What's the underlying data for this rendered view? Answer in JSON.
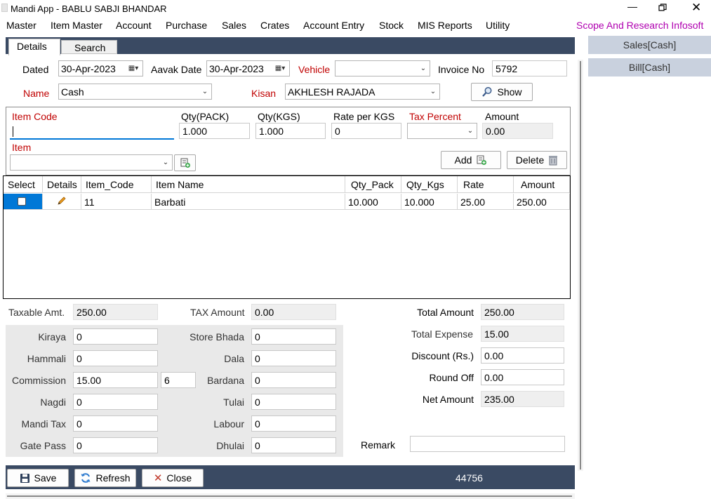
{
  "window": {
    "title": "Mandi App - BABLU SABJI BHANDAR"
  },
  "menu": {
    "items": [
      "Master",
      "Item Master",
      "Account",
      "Purchase",
      "Sales",
      "Crates",
      "Account Entry",
      "Stock",
      "MIS Reports",
      "Utility"
    ],
    "brand": "Scope And Research Infosoft"
  },
  "tabs": {
    "details": "Details",
    "search": "Search"
  },
  "side_buttons": {
    "sales_cash": "Sales[Cash]",
    "bill_cash": "Bill[Cash]"
  },
  "header": {
    "dated_label": "Dated",
    "dated_value": "30-Apr-2023",
    "aavak_label": "Aavak Date",
    "aavak_value": "30-Apr-2023",
    "vehicle_label": "Vehicle",
    "vehicle_value": "",
    "invoice_label": "Invoice No",
    "invoice_value": "5792",
    "name_label": "Name",
    "name_value": "Cash",
    "kisan_label": "Kisan",
    "kisan_value": "AKHLESH RAJADA",
    "show_label": "Show"
  },
  "entry": {
    "item_code_label": "Item Code",
    "item_code_value": "",
    "qty_pack_label": "Qty(PACK)",
    "qty_pack_value": "1.000",
    "qty_kgs_label": "Qty(KGS)",
    "qty_kgs_value": "1.000",
    "rate_label": "Rate per KGS",
    "rate_value": "0",
    "tax_label": "Tax Percent",
    "tax_value": "",
    "amount_label": "Amount",
    "amount_value": "0.00",
    "item_label": "Item",
    "item_value": "",
    "add_label": "Add",
    "delete_label": "Delete"
  },
  "grid": {
    "columns": [
      "Select",
      "Details",
      "Item_Code",
      "Item Name",
      "Qty_Pack",
      "Qty_Kgs",
      "Rate",
      "Amount"
    ],
    "rows": [
      {
        "item_code": "11",
        "item_name": "Barbati",
        "qty_pack": "10.000",
        "qty_kgs": "10.000",
        "rate": "25.00",
        "amount": "250.00"
      }
    ]
  },
  "summary": {
    "taxable_label": "Taxable Amt.",
    "taxable_value": "250.00",
    "tax_amount_label": "TAX Amount",
    "tax_amount_value": "0.00",
    "total_amount_label": "Total Amount",
    "total_amount_value": "250.00",
    "total_expense_label": "Total Expense",
    "total_expense_value": "15.00",
    "discount_label": "Discount (Rs.)",
    "discount_value": "0.00",
    "round_off_label": "Round Off",
    "round_off_value": "0.00",
    "net_amount_label": "Net Amount",
    "net_amount_value": "235.00",
    "remark_label": "Remark",
    "remark_value": ""
  },
  "expenses": {
    "kiraya_label": "Kiraya",
    "kiraya_value": "0",
    "hammali_label": "Hammali",
    "hammali_value": "0",
    "commission_label": "Commission",
    "commission_value": "15.00",
    "commission_pct": "6",
    "nagdi_label": "Nagdi",
    "nagdi_value": "0",
    "mandi_tax_label": "Mandi Tax",
    "mandi_tax_value": "0",
    "gate_pass_label": "Gate Pass",
    "gate_pass_value": "0",
    "store_bhada_label": "Store Bhada",
    "store_bhada_value": "0",
    "dala_label": "Dala",
    "dala_value": "0",
    "bardana_label": "Bardana",
    "bardana_value": "0",
    "tulai_label": "Tulai",
    "tulai_value": "0",
    "labour_label": "Labour",
    "labour_value": "0",
    "dhulai_label": "Dhulai",
    "dhulai_value": "0"
  },
  "footer": {
    "save_label": "Save",
    "refresh_label": "Refresh",
    "close_label": "Close",
    "record_count": "44756"
  },
  "colors": {
    "navy": "#3a4a63",
    "label_red": "#c00000",
    "brand_magenta": "#b000b0",
    "selection_blue": "#0078d7",
    "side_button_bg": "#c9d1de"
  }
}
